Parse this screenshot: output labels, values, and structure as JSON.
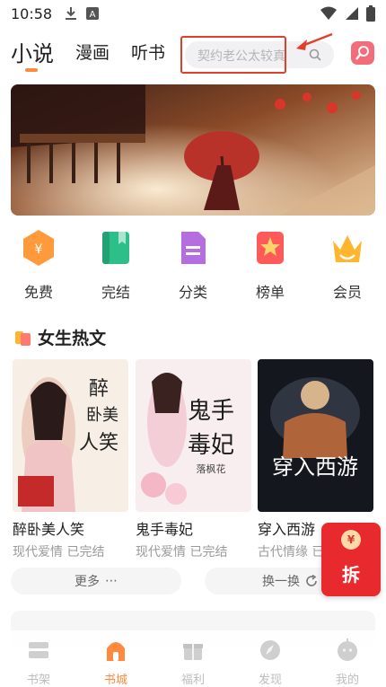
{
  "status_bar": {
    "time": "10:58"
  },
  "top_tabs": [
    {
      "label": "小说",
      "active": true
    },
    {
      "label": "漫画",
      "active": false
    },
    {
      "label": "听书",
      "active": false
    }
  ],
  "search": {
    "placeholder": "契约老公太较真"
  },
  "categories": [
    {
      "label": "免费",
      "icon": "free-coin-icon",
      "color": "#ff9a3c"
    },
    {
      "label": "完结",
      "icon": "book-icon",
      "color": "#2dbf8a"
    },
    {
      "label": "分类",
      "icon": "document-icon",
      "color": "#b56ee0"
    },
    {
      "label": "榜单",
      "icon": "ranking-star-icon",
      "color": "#ff5a5a"
    },
    {
      "label": "会员",
      "icon": "crown-icon",
      "color": "#ffb52e"
    }
  ],
  "section": {
    "title": "女生热文"
  },
  "books": [
    {
      "title": "醉卧美人笑",
      "meta": "现代爱情 已完结",
      "cover_text": "醉卧美人笑"
    },
    {
      "title": "鬼手毒妃",
      "meta": "现代爱情 已完结",
      "cover_text": "鬼手毒妃",
      "cover_author": "落枫花"
    },
    {
      "title": "穿入西游",
      "meta": "古代情缘 已完结",
      "cover_text": "穿入西游"
    }
  ],
  "actions": {
    "more": "更多",
    "refresh": "换一换"
  },
  "red_packet": {
    "label": "拆",
    "coin": "¥"
  },
  "bottom_nav": [
    {
      "label": "书架",
      "active": false
    },
    {
      "label": "书城",
      "active": true
    },
    {
      "label": "福利",
      "active": false
    },
    {
      "label": "发现",
      "active": false
    },
    {
      "label": "我的",
      "active": false
    }
  ],
  "colors": {
    "accent": "#ff8a3d",
    "annotation": "#e0402a",
    "red_packet": "#e8292d"
  }
}
